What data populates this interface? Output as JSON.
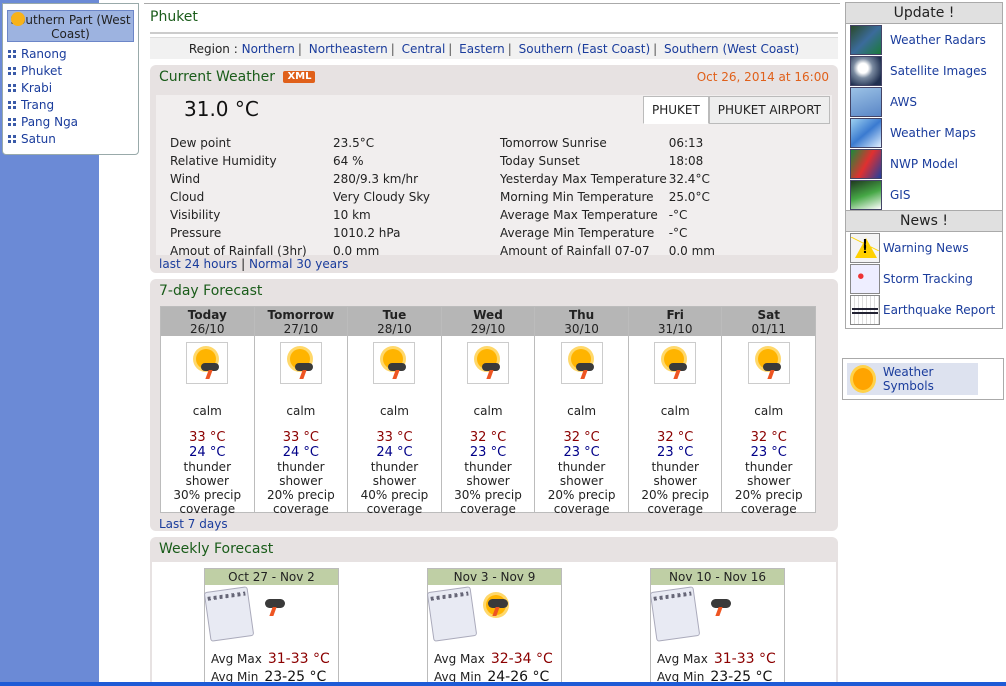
{
  "sidebar": {
    "selected": "Southern Part (West Coast)",
    "provinces": [
      "Ranong",
      "Phuket",
      "Krabi",
      "Trang",
      "Pang Nga",
      "Satun"
    ]
  },
  "page_title": "Phuket",
  "regions": {
    "prefix": "Region : ",
    "items": [
      "Northern",
      "Northeastern",
      "Central",
      "Eastern",
      "Southern (East Coast)",
      "Southern (West Coast)"
    ]
  },
  "current": {
    "header": "Current Weather",
    "xml_badge": "XML",
    "datetime": "Oct 26, 2014 at 16:00",
    "temperature": "31.0 °C",
    "tabs": [
      "PHUKET",
      "PHUKET AIRPORT"
    ],
    "left": [
      {
        "label": "Dew point",
        "value": "23.5°C"
      },
      {
        "label": "Relative Humidity",
        "value": "64 %"
      },
      {
        "label": "Wind",
        "value": "280/9.3 km/hr"
      },
      {
        "label": "Cloud",
        "value": "Very Cloudy Sky"
      },
      {
        "label": "Visibility",
        "value": "10 km"
      },
      {
        "label": "Pressure",
        "value": "1010.2 hPa"
      },
      {
        "label": "Amout of Rainfall (3hr)",
        "value": "0.0 mm"
      }
    ],
    "right": [
      {
        "label": "Tomorrow Sunrise",
        "value": "06:13"
      },
      {
        "label": "Today Sunset",
        "value": "18:08"
      },
      {
        "label": "Yesterday Max Temperature",
        "value": "32.4°C"
      },
      {
        "label": "Morning Min Temperature",
        "value": "25.0°C"
      },
      {
        "label": "Average Max Temperature",
        "value": "-°C"
      },
      {
        "label": "Average Min Temperature",
        "value": "-°C"
      },
      {
        "label": "Amount of Rainfall 07-07",
        "value": "0.0 mm"
      }
    ],
    "link_24h": "last 24 hours",
    "link_sep": "|",
    "link_normal": "Normal 30 years"
  },
  "forecast": {
    "header": "7-day Forecast",
    "days": [
      {
        "day": "Today",
        "date": "26/10",
        "wind": "calm",
        "max": "33 °C",
        "min": "24 °C",
        "cond": "thunder shower",
        "precip": "30% precip",
        "cov": "coverage"
      },
      {
        "day": "Tomorrow",
        "date": "27/10",
        "wind": "calm",
        "max": "33 °C",
        "min": "24 °C",
        "cond": "thunder shower",
        "precip": "20% precip",
        "cov": "coverage"
      },
      {
        "day": "Tue",
        "date": "28/10",
        "wind": "calm",
        "max": "33 °C",
        "min": "24 °C",
        "cond": "thunder shower",
        "precip": "40% precip",
        "cov": "coverage"
      },
      {
        "day": "Wed",
        "date": "29/10",
        "wind": "calm",
        "max": "32 °C",
        "min": "23 °C",
        "cond": "thunder shower",
        "precip": "30% precip",
        "cov": "coverage"
      },
      {
        "day": "Thu",
        "date": "30/10",
        "wind": "calm",
        "max": "32 °C",
        "min": "23 °C",
        "cond": "thunder shower",
        "precip": "20% precip",
        "cov": "coverage"
      },
      {
        "day": "Fri",
        "date": "31/10",
        "wind": "calm",
        "max": "32 °C",
        "min": "23 °C",
        "cond": "thunder shower",
        "precip": "20% precip",
        "cov": "coverage"
      },
      {
        "day": "Sat",
        "date": "01/11",
        "wind": "calm",
        "max": "32 °C",
        "min": "23 °C",
        "cond": "thunder shower",
        "precip": "20% precip",
        "cov": "coverage"
      }
    ],
    "link_last7": "Last 7 days"
  },
  "weekly": {
    "header": "Weekly Forecast",
    "max_label": "Avg Max",
    "min_label": "Avg Min",
    "weeks": [
      {
        "range": "Oct 27 - Nov 2",
        "max": "31-33 °C",
        "min": "23-25 °C",
        "icon": "thunder-icon"
      },
      {
        "range": "Nov 3 - Nov 9",
        "max": "32-34 °C",
        "min": "24-26 °C",
        "icon": "sun-thunder-icon"
      },
      {
        "range": "Nov 10 - Nov 16",
        "max": "31-33 °C",
        "min": "23-25 °C",
        "icon": "thunder-icon"
      }
    ]
  },
  "right": {
    "update_header": "Update !",
    "updates": [
      "Weather Radars",
      "Satellite Images",
      "AWS",
      "Weather Maps",
      "NWP Model",
      "GIS"
    ],
    "news_header": "News !",
    "news": [
      "Warning News",
      "Storm Tracking",
      "Earthquake Report"
    ],
    "symbols": "Weather Symbols"
  },
  "colors": {
    "accent_green": "#1a5c1a",
    "date_orange": "#e0601a",
    "link_blue": "#1a3c9c",
    "max_temp": "#8b0000",
    "min_temp": "#000088"
  }
}
